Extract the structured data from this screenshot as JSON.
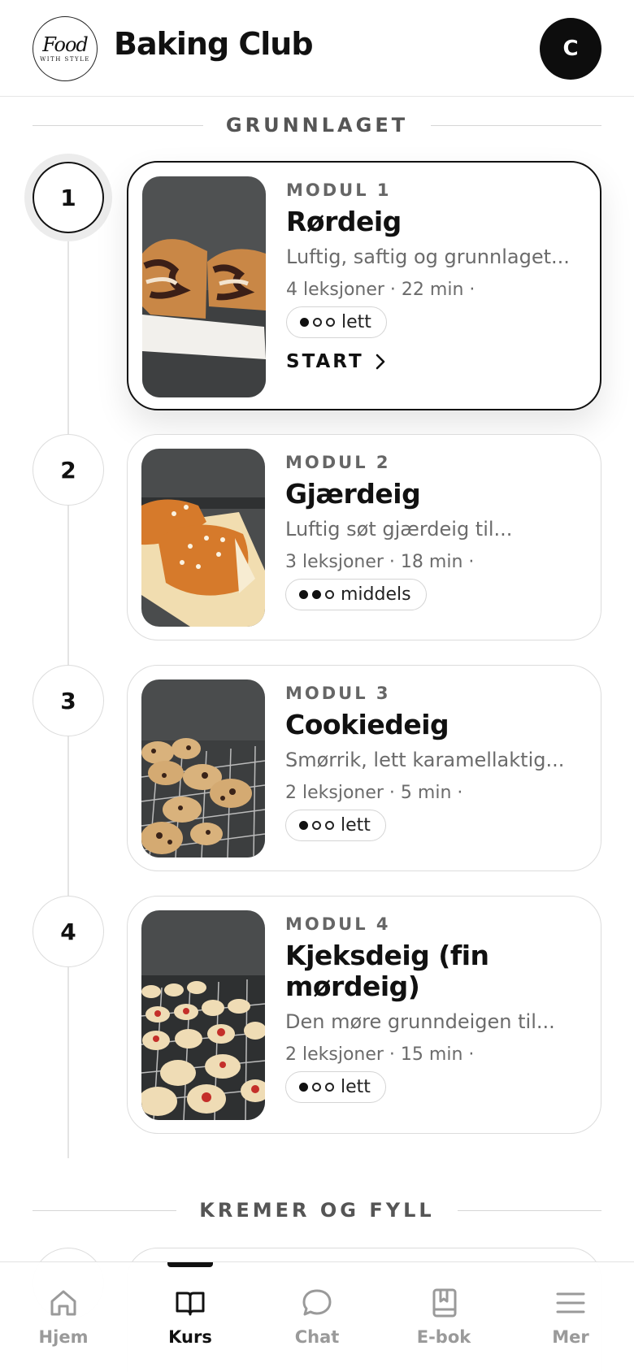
{
  "header": {
    "logo_script": "Food",
    "logo_sub": "WITH STYLE",
    "title": "Baking Club",
    "avatar_initial": "C"
  },
  "sections": [
    {
      "label": "GRUNNLAGET"
    },
    {
      "label": "KREMER OG FYLL"
    }
  ],
  "modules": [
    {
      "number": "1",
      "kicker": "MODUL 1",
      "title": "Rørdeig",
      "description": "Luftig, saftig og grunnlaget...",
      "meta": "4 leksjoner · 22 min ·",
      "difficulty": "lett",
      "level": 1,
      "start_label": "START",
      "image": "marble-cake"
    },
    {
      "number": "2",
      "kicker": "MODUL 2",
      "title": "Gjærdeig",
      "description": "Luftig søt gjærdeig til...",
      "meta": "3 leksjoner · 18 min ·",
      "difficulty": "middels",
      "level": 2,
      "image": "braided-bread"
    },
    {
      "number": "3",
      "kicker": "MODUL 3",
      "title": "Cookiedeig",
      "description": "Smørrik, lett karamellaktig...",
      "meta": "2 leksjoner · 5 min ·",
      "difficulty": "lett",
      "level": 1,
      "image": "chocolate-chip-cookies"
    },
    {
      "number": "4",
      "kicker": "MODUL 4",
      "title": "Kjeksdeig (fin mørdeig)",
      "description": "Den møre grunndeigen til...",
      "meta": "2 leksjoner · 15 min ·",
      "difficulty": "lett",
      "level": 1,
      "image": "jam-thumbprint-cookies"
    }
  ],
  "nav": [
    {
      "label": "Hjem",
      "icon": "home-icon"
    },
    {
      "label": "Kurs",
      "icon": "book-icon",
      "active": true
    },
    {
      "label": "Chat",
      "icon": "chat-icon"
    },
    {
      "label": "E-bok",
      "icon": "ebook-icon"
    },
    {
      "label": "Mer",
      "icon": "menu-icon"
    }
  ],
  "colors": {
    "accent": "#111111",
    "muted": "#6b6b6b",
    "border": "#dcdcdc"
  }
}
